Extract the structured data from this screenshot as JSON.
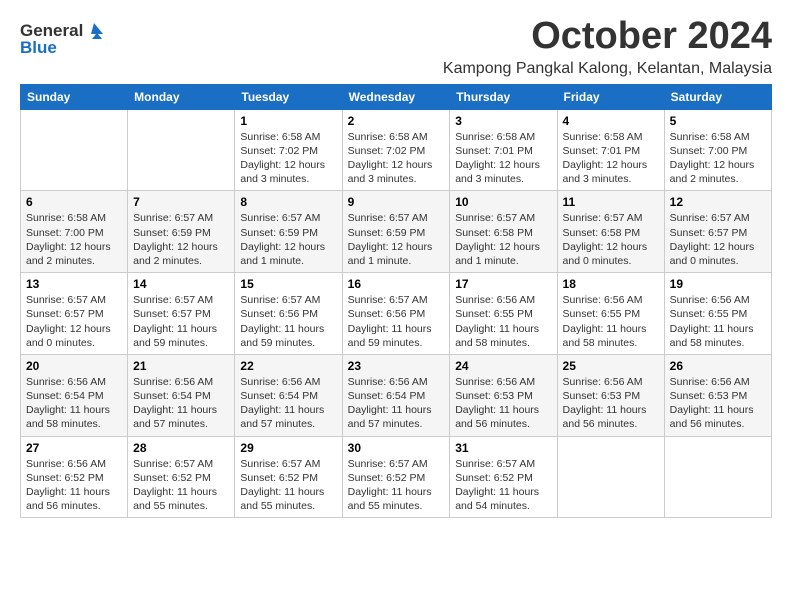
{
  "logo": {
    "general": "General",
    "blue": "Blue"
  },
  "header": {
    "month": "October 2024",
    "location": "Kampong Pangkal Kalong, Kelantan, Malaysia"
  },
  "weekdays": [
    "Sunday",
    "Monday",
    "Tuesday",
    "Wednesday",
    "Thursday",
    "Friday",
    "Saturday"
  ],
  "weeks": [
    [
      {
        "day": "",
        "info": ""
      },
      {
        "day": "",
        "info": ""
      },
      {
        "day": "1",
        "info": "Sunrise: 6:58 AM\nSunset: 7:02 PM\nDaylight: 12 hours and 3 minutes."
      },
      {
        "day": "2",
        "info": "Sunrise: 6:58 AM\nSunset: 7:02 PM\nDaylight: 12 hours and 3 minutes."
      },
      {
        "day": "3",
        "info": "Sunrise: 6:58 AM\nSunset: 7:01 PM\nDaylight: 12 hours and 3 minutes."
      },
      {
        "day": "4",
        "info": "Sunrise: 6:58 AM\nSunset: 7:01 PM\nDaylight: 12 hours and 3 minutes."
      },
      {
        "day": "5",
        "info": "Sunrise: 6:58 AM\nSunset: 7:00 PM\nDaylight: 12 hours and 2 minutes."
      }
    ],
    [
      {
        "day": "6",
        "info": "Sunrise: 6:58 AM\nSunset: 7:00 PM\nDaylight: 12 hours and 2 minutes."
      },
      {
        "day": "7",
        "info": "Sunrise: 6:57 AM\nSunset: 6:59 PM\nDaylight: 12 hours and 2 minutes."
      },
      {
        "day": "8",
        "info": "Sunrise: 6:57 AM\nSunset: 6:59 PM\nDaylight: 12 hours and 1 minute."
      },
      {
        "day": "9",
        "info": "Sunrise: 6:57 AM\nSunset: 6:59 PM\nDaylight: 12 hours and 1 minute."
      },
      {
        "day": "10",
        "info": "Sunrise: 6:57 AM\nSunset: 6:58 PM\nDaylight: 12 hours and 1 minute."
      },
      {
        "day": "11",
        "info": "Sunrise: 6:57 AM\nSunset: 6:58 PM\nDaylight: 12 hours and 0 minutes."
      },
      {
        "day": "12",
        "info": "Sunrise: 6:57 AM\nSunset: 6:57 PM\nDaylight: 12 hours and 0 minutes."
      }
    ],
    [
      {
        "day": "13",
        "info": "Sunrise: 6:57 AM\nSunset: 6:57 PM\nDaylight: 12 hours and 0 minutes."
      },
      {
        "day": "14",
        "info": "Sunrise: 6:57 AM\nSunset: 6:57 PM\nDaylight: 11 hours and 59 minutes."
      },
      {
        "day": "15",
        "info": "Sunrise: 6:57 AM\nSunset: 6:56 PM\nDaylight: 11 hours and 59 minutes."
      },
      {
        "day": "16",
        "info": "Sunrise: 6:57 AM\nSunset: 6:56 PM\nDaylight: 11 hours and 59 minutes."
      },
      {
        "day": "17",
        "info": "Sunrise: 6:56 AM\nSunset: 6:55 PM\nDaylight: 11 hours and 58 minutes."
      },
      {
        "day": "18",
        "info": "Sunrise: 6:56 AM\nSunset: 6:55 PM\nDaylight: 11 hours and 58 minutes."
      },
      {
        "day": "19",
        "info": "Sunrise: 6:56 AM\nSunset: 6:55 PM\nDaylight: 11 hours and 58 minutes."
      }
    ],
    [
      {
        "day": "20",
        "info": "Sunrise: 6:56 AM\nSunset: 6:54 PM\nDaylight: 11 hours and 58 minutes."
      },
      {
        "day": "21",
        "info": "Sunrise: 6:56 AM\nSunset: 6:54 PM\nDaylight: 11 hours and 57 minutes."
      },
      {
        "day": "22",
        "info": "Sunrise: 6:56 AM\nSunset: 6:54 PM\nDaylight: 11 hours and 57 minutes."
      },
      {
        "day": "23",
        "info": "Sunrise: 6:56 AM\nSunset: 6:54 PM\nDaylight: 11 hours and 57 minutes."
      },
      {
        "day": "24",
        "info": "Sunrise: 6:56 AM\nSunset: 6:53 PM\nDaylight: 11 hours and 56 minutes."
      },
      {
        "day": "25",
        "info": "Sunrise: 6:56 AM\nSunset: 6:53 PM\nDaylight: 11 hours and 56 minutes."
      },
      {
        "day": "26",
        "info": "Sunrise: 6:56 AM\nSunset: 6:53 PM\nDaylight: 11 hours and 56 minutes."
      }
    ],
    [
      {
        "day": "27",
        "info": "Sunrise: 6:56 AM\nSunset: 6:52 PM\nDaylight: 11 hours and 56 minutes."
      },
      {
        "day": "28",
        "info": "Sunrise: 6:57 AM\nSunset: 6:52 PM\nDaylight: 11 hours and 55 minutes."
      },
      {
        "day": "29",
        "info": "Sunrise: 6:57 AM\nSunset: 6:52 PM\nDaylight: 11 hours and 55 minutes."
      },
      {
        "day": "30",
        "info": "Sunrise: 6:57 AM\nSunset: 6:52 PM\nDaylight: 11 hours and 55 minutes."
      },
      {
        "day": "31",
        "info": "Sunrise: 6:57 AM\nSunset: 6:52 PM\nDaylight: 11 hours and 54 minutes."
      },
      {
        "day": "",
        "info": ""
      },
      {
        "day": "",
        "info": ""
      }
    ]
  ]
}
